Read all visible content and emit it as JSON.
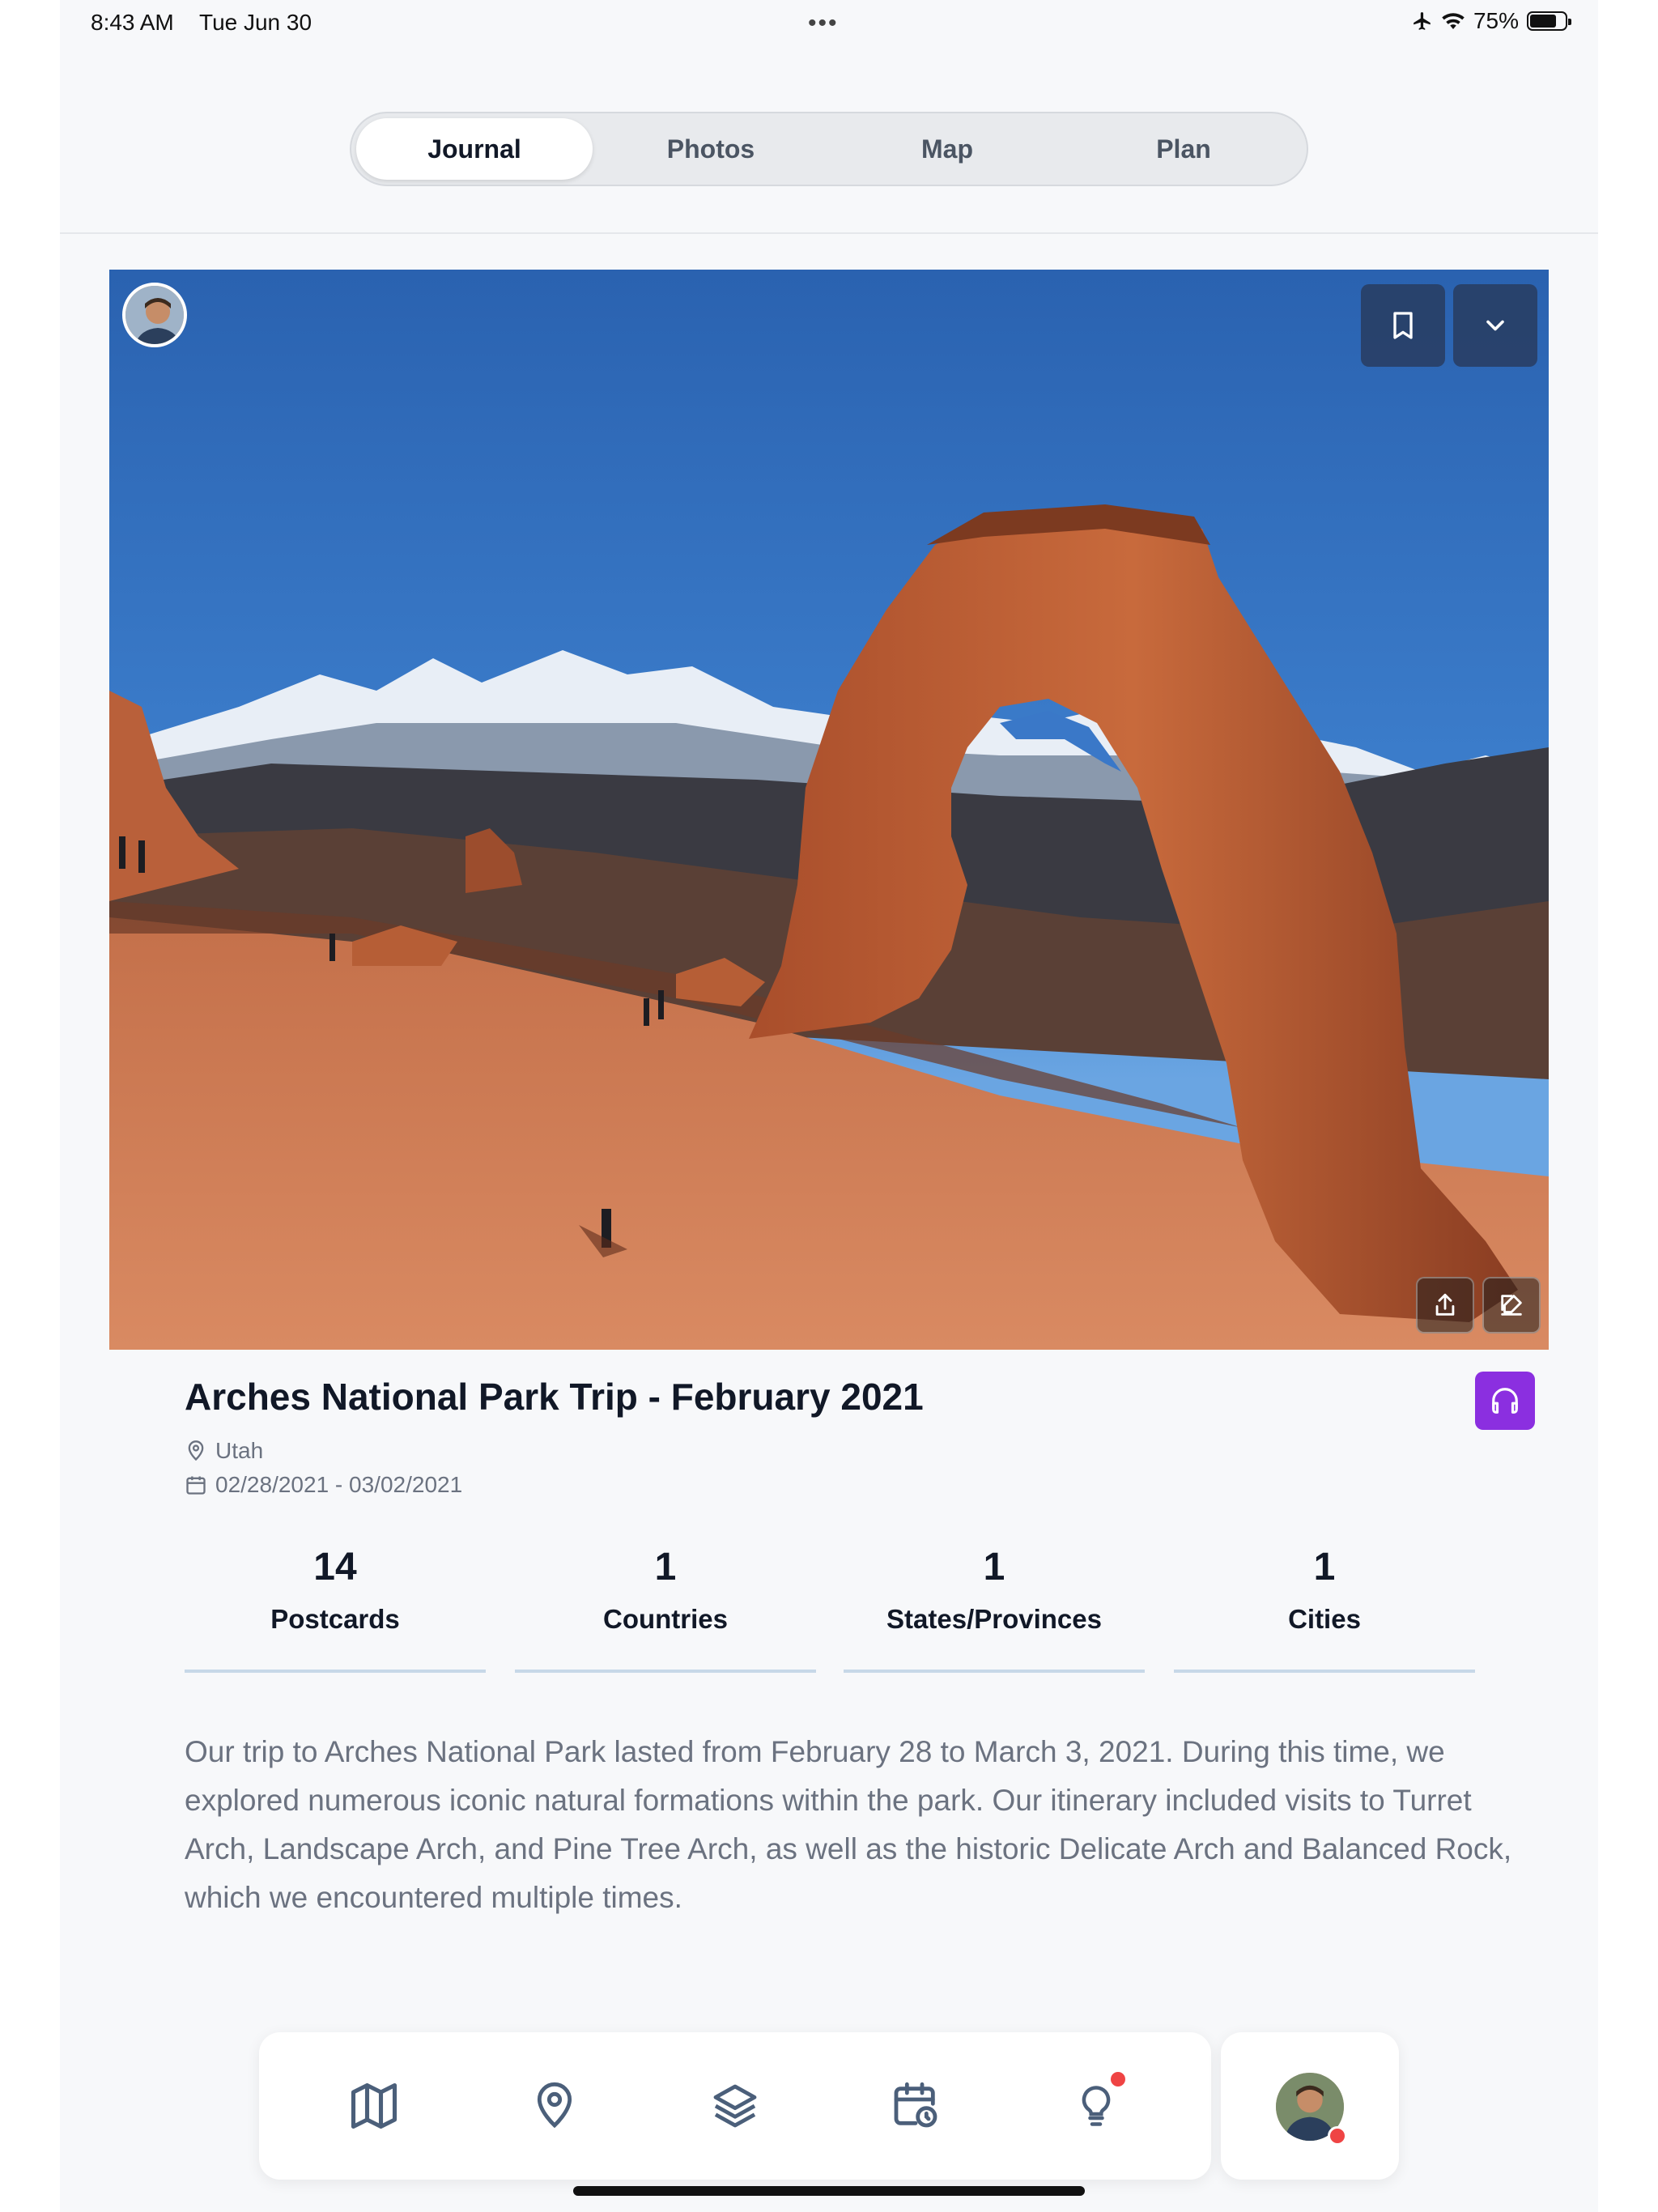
{
  "status_bar": {
    "time": "8:43 AM",
    "date": "Tue Jun 30",
    "battery": "75%",
    "battery_level": 0.75,
    "icons": [
      "airplane-icon",
      "wifi-icon",
      "battery-icon"
    ]
  },
  "tabs": [
    {
      "label": "Journal",
      "active": true
    },
    {
      "label": "Photos",
      "active": false
    },
    {
      "label": "Map",
      "active": false
    },
    {
      "label": "Plan",
      "active": false
    }
  ],
  "hero": {
    "icons": [
      "bookmark-icon",
      "chevron-down-icon",
      "share-icon",
      "edit-icon"
    ]
  },
  "trip": {
    "title": "Arches National Park Trip - February 2021",
    "location": "Utah",
    "dates": "02/28/2021 - 03/02/2021"
  },
  "stats": [
    {
      "value": "14",
      "label": "Postcards"
    },
    {
      "value": "1",
      "label": "Countries"
    },
    {
      "value": "1",
      "label": "States/Provinces"
    },
    {
      "value": "1",
      "label": "Cities"
    }
  ],
  "description": "Our trip to Arches National Park lasted from February 28 to March 3, 2021. During this time, we explored numerous iconic natural formations within the park. Our itinerary included visits to Turret Arch, Landscape Arch, and Pine Tree Arch, as well as the historic Delicate Arch and Balanced Rock, which we encountered multiple times.",
  "bottom_nav": {
    "items": [
      "map-icon",
      "location-pin-icon",
      "layers-icon",
      "calendar-clock-icon",
      "lightbulb-icon"
    ]
  },
  "colors": {
    "accent_purple": "#8b2fe0",
    "notification_red": "#ef4444",
    "stat_underline": "#c7d8e8",
    "text_muted": "#6b7280"
  }
}
